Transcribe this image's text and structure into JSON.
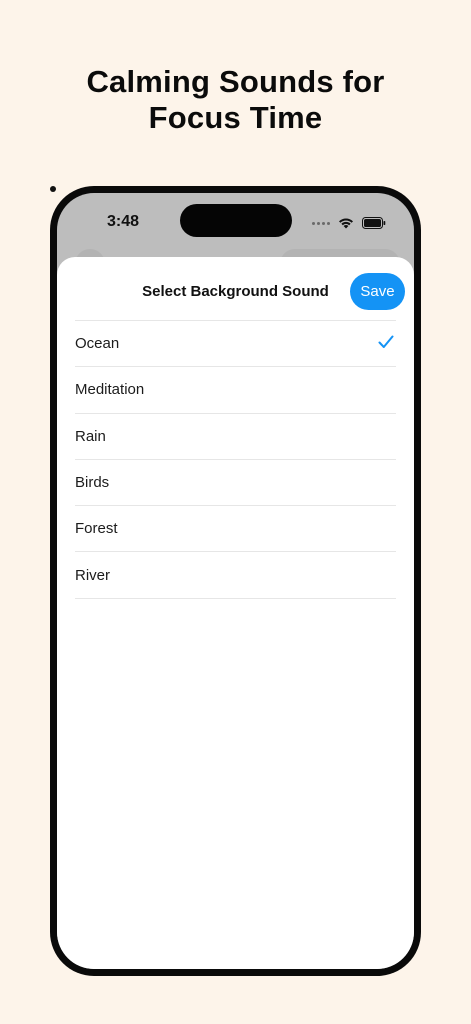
{
  "headline": {
    "line1": "Calming Sounds for",
    "line2": "Focus Time"
  },
  "status_bar": {
    "time": "3:48",
    "icons": [
      "cellular-dots-icon",
      "wifi-icon",
      "battery-icon"
    ]
  },
  "sheet": {
    "title": "Select Background Sound",
    "save_label": "Save",
    "options": [
      {
        "label": "Ocean",
        "selected": true
      },
      {
        "label": "Meditation",
        "selected": false
      },
      {
        "label": "Rain",
        "selected": false
      },
      {
        "label": "Birds",
        "selected": false
      },
      {
        "label": "Forest",
        "selected": false
      },
      {
        "label": "River",
        "selected": false
      }
    ]
  },
  "colors": {
    "background": "#fdf4ea",
    "accent": "#1493f5",
    "phone_frame": "#0a0a0a"
  }
}
